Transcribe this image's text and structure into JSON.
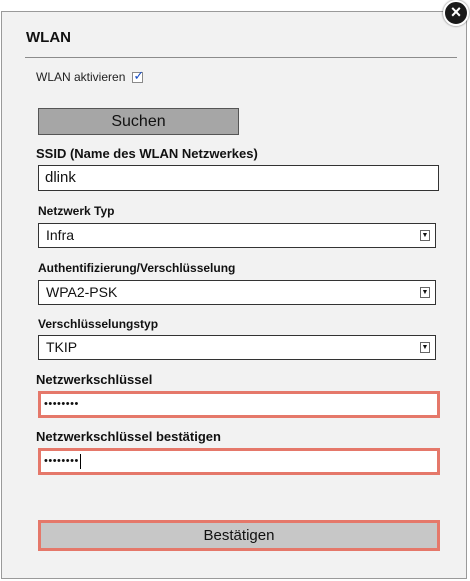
{
  "dialog": {
    "title": "WLAN",
    "close_symbol": "×",
    "enable": {
      "label": "WLAN aktivieren",
      "checked": true,
      "check_glyph": "✓"
    },
    "search_button": "Suchen",
    "ssid": {
      "label": "SSID (Name des WLAN Netzwerkes)",
      "value": "dlink"
    },
    "network_type": {
      "label": "Netzwerk Typ",
      "value": "Infra"
    },
    "authentication": {
      "label": "Authentifizierung/Verschlüsselung",
      "value": "WPA2-PSK"
    },
    "encryption_type": {
      "label": "Verschlüsselungstyp",
      "value": "TKIP"
    },
    "network_key": {
      "label": "Netzwerkschlüssel",
      "value": "••••••••"
    },
    "network_key_confirm": {
      "label": "Netzwerkschlüssel bestätigen",
      "value": "••••••••"
    },
    "confirm_button": "Bestätigen",
    "select_arrow_glyph": "▼"
  },
  "colors": {
    "highlight_border": "#e5786a",
    "panel_bg": "#f2f2f2",
    "search_button_bg": "#a6a6a6",
    "confirm_button_bg": "#c7c7c7"
  },
  "icons": {
    "close": "close-icon",
    "checkbox": "checkmark-icon",
    "dropdown": "dropdown-arrow-icon"
  }
}
